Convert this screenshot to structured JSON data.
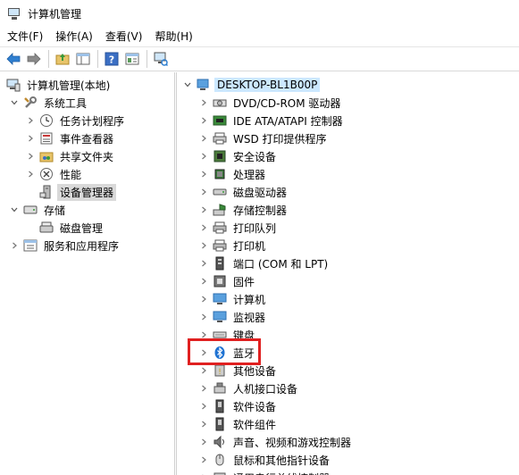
{
  "window": {
    "title": "计算机管理"
  },
  "menu": [
    {
      "key": "file",
      "label": "文件(F)"
    },
    {
      "key": "action",
      "label": "操作(A)"
    },
    {
      "key": "view",
      "label": "查看(V)"
    },
    {
      "key": "help",
      "label": "帮助(H)"
    }
  ],
  "toolbar": {
    "buttons": [
      "back-arrow-icon",
      "forward-arrow-icon",
      "up-folder-icon",
      "show-hide-tree-icon",
      "help-icon",
      "properties-icon",
      "monitor-scan-icon"
    ]
  },
  "left_tree": {
    "root": "计算机管理(本地)",
    "system_tools": "系统工具",
    "task_scheduler": "任务计划程序",
    "event_viewer": "事件查看器",
    "shared_folders": "共享文件夹",
    "performance": "性能",
    "device_manager": "设备管理器",
    "storage": "存储",
    "disk_management": "磁盘管理",
    "services_apps": "服务和应用程序"
  },
  "right_tree": {
    "computer_name": "DESKTOP-BL1B00P",
    "items": [
      {
        "label": "DVD/CD-ROM 驱动器",
        "icon": "dvd-drive-icon"
      },
      {
        "label": "IDE ATA/ATAPI 控制器",
        "icon": "ide-controller-icon"
      },
      {
        "label": "WSD 打印提供程序",
        "icon": "wsd-printer-icon"
      },
      {
        "label": "安全设备",
        "icon": "security-device-icon"
      },
      {
        "label": "处理器",
        "icon": "processor-icon"
      },
      {
        "label": "磁盘驱动器",
        "icon": "disk-drive-icon"
      },
      {
        "label": "存储控制器",
        "icon": "storage-controller-icon"
      },
      {
        "label": "打印队列",
        "icon": "print-queue-icon"
      },
      {
        "label": "打印机",
        "icon": "printer-icon"
      },
      {
        "label": "端口 (COM 和 LPT)",
        "icon": "port-icon"
      },
      {
        "label": "固件",
        "icon": "firmware-icon"
      },
      {
        "label": "计算机",
        "icon": "computer-icon"
      },
      {
        "label": "监视器",
        "icon": "monitor-icon"
      },
      {
        "label": "键盘",
        "icon": "keyboard-icon"
      },
      {
        "label": "蓝牙",
        "icon": "bluetooth-icon"
      },
      {
        "label": "其他设备",
        "icon": "other-device-icon"
      },
      {
        "label": "人机接口设备",
        "icon": "hid-icon"
      },
      {
        "label": "软件设备",
        "icon": "software-device-icon"
      },
      {
        "label": "软件组件",
        "icon": "software-component-icon"
      },
      {
        "label": "声音、视频和游戏控制器",
        "icon": "sound-icon"
      },
      {
        "label": "鼠标和其他指针设备",
        "icon": "mouse-icon"
      },
      {
        "label": "通用串行总线控制器",
        "icon": "usb-icon"
      }
    ]
  },
  "colors": {
    "highlight_box": "#e02020",
    "selected_bg": "#d9d9d9",
    "computer_name_bg": "#cce8ff"
  }
}
